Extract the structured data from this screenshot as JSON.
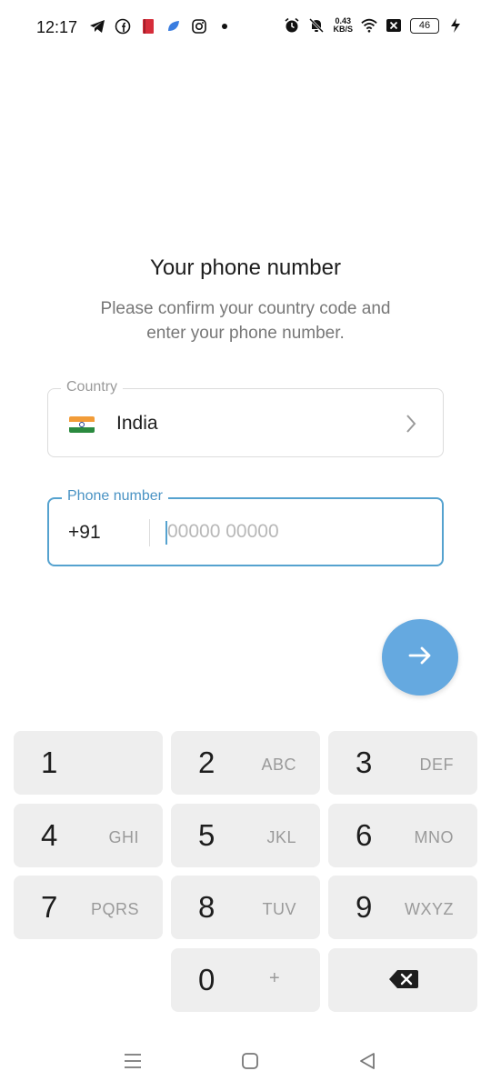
{
  "status_bar": {
    "time": "12:17",
    "left_icons": [
      "telegram-icon",
      "facebook-icon",
      "book-icon",
      "app-icon",
      "instagram-icon",
      "dot-icon"
    ],
    "net_speed_value": "0.43",
    "net_speed_unit": "KB/S",
    "battery": "46"
  },
  "header": {
    "title": "Your phone number",
    "subtitle": "Please confirm your country code and enter your phone number."
  },
  "country_field": {
    "label": "Country",
    "value": "India",
    "flag": "india-flag"
  },
  "phone_field": {
    "label": "Phone number",
    "code": "+91",
    "placeholder": "00000 00000",
    "value": ""
  },
  "colors": {
    "accent": "#55a2cf",
    "fab": "#65a9e0",
    "key_bg": "#eeeeee"
  },
  "keypad": {
    "keys": [
      {
        "digit": "1",
        "letters": ""
      },
      {
        "digit": "2",
        "letters": "ABC"
      },
      {
        "digit": "3",
        "letters": "DEF"
      },
      {
        "digit": "4",
        "letters": "GHI"
      },
      {
        "digit": "5",
        "letters": "JKL"
      },
      {
        "digit": "6",
        "letters": "MNO"
      },
      {
        "digit": "7",
        "letters": "PQRS"
      },
      {
        "digit": "8",
        "letters": "TUV"
      },
      {
        "digit": "9",
        "letters": "WXYZ"
      },
      {
        "digit": "0",
        "letters": "+"
      }
    ]
  }
}
